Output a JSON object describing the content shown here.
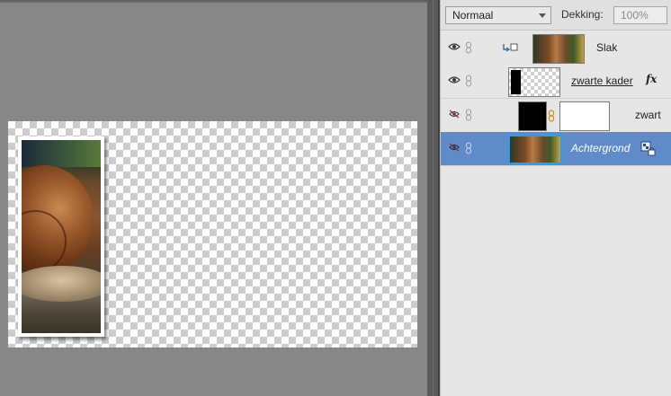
{
  "layers_panel": {
    "blend_mode": "Normaal",
    "opacity_label": "Dekking:",
    "opacity_value": "100%",
    "layers": [
      {
        "name": "Slak",
        "visible": true,
        "clipped": true,
        "thumbnail": "photo"
      },
      {
        "name": "zwarte kader",
        "visible": true,
        "effects_label": "fx",
        "thumbnail": "transparent-with-black-bar"
      },
      {
        "name": "zwart",
        "visible": false,
        "thumbnail": "black-fill",
        "mask": "white"
      },
      {
        "name": "Achtergrond",
        "visible": false,
        "selected": true,
        "locked": true,
        "thumbnail": "photo"
      }
    ]
  },
  "colors": {
    "selected_row": "#5f8cc8",
    "thumbnail_highlight": "#1fa0ff",
    "canvas_bg": "#878787",
    "panel_bg": "#e6e6e6"
  },
  "icons": [
    "eye-icon",
    "eye-hidden-icon",
    "link-icon",
    "clip-arrow-icon",
    "fx-icon",
    "lock-icon"
  ]
}
